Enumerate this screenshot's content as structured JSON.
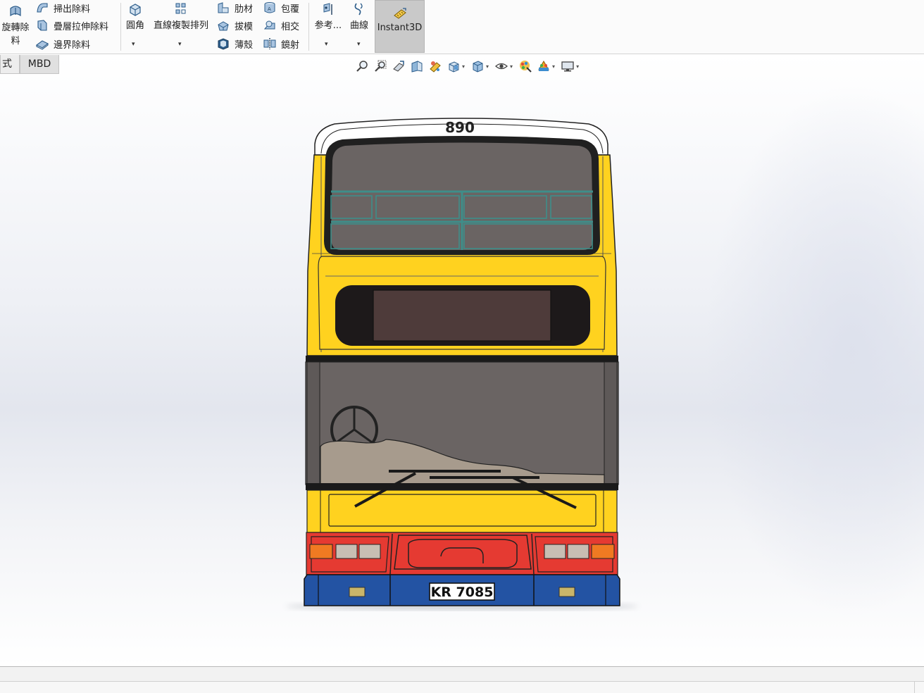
{
  "ribbon": {
    "revolve_cut_label_line1": "旋轉除",
    "revolve_cut_label_line2": "料",
    "swept_cut_label": "掃出除料",
    "loft_cut_label": "疊層拉伸除料",
    "boundary_cut_label": "邊界除料",
    "fillet_label": "圓角",
    "linear_pattern_label": "直線複製排列",
    "rib_label": "肋材",
    "draft_label": "拔模",
    "shell_label": "薄殼",
    "wrap_label": "包覆",
    "intersect_label": "相交",
    "mirror_label": "鏡射",
    "reference_label": "参考...",
    "curves_label": "曲線",
    "instant3d_label": "Instant3D"
  },
  "tabs": {
    "partial_tab_label": "式",
    "mbd_tab_label": "MBD"
  },
  "heads_up_toolbar": {
    "icons": [
      "zoom-to-fit-icon",
      "zoom-to-area-icon",
      "previous-view-icon",
      "section-view-icon",
      "view-palette-icon",
      "view-orientation-icon",
      "display-style-icon",
      "hide-show-items-icon",
      "edit-appearance-icon",
      "apply-scene-icon",
      "view-settings-icon"
    ]
  },
  "model": {
    "fleet_number": "890",
    "registration_plate": "KR 7085",
    "colors": {
      "body_yellow": "#FFD21F",
      "window_grey": "#6A6463",
      "display_brown": "#4E3B3A",
      "window_bars": "#3E8E8A",
      "engine_red": "#E53A32",
      "bumper_blue": "#2353A3",
      "lamp_orange": "#F07A22"
    }
  }
}
